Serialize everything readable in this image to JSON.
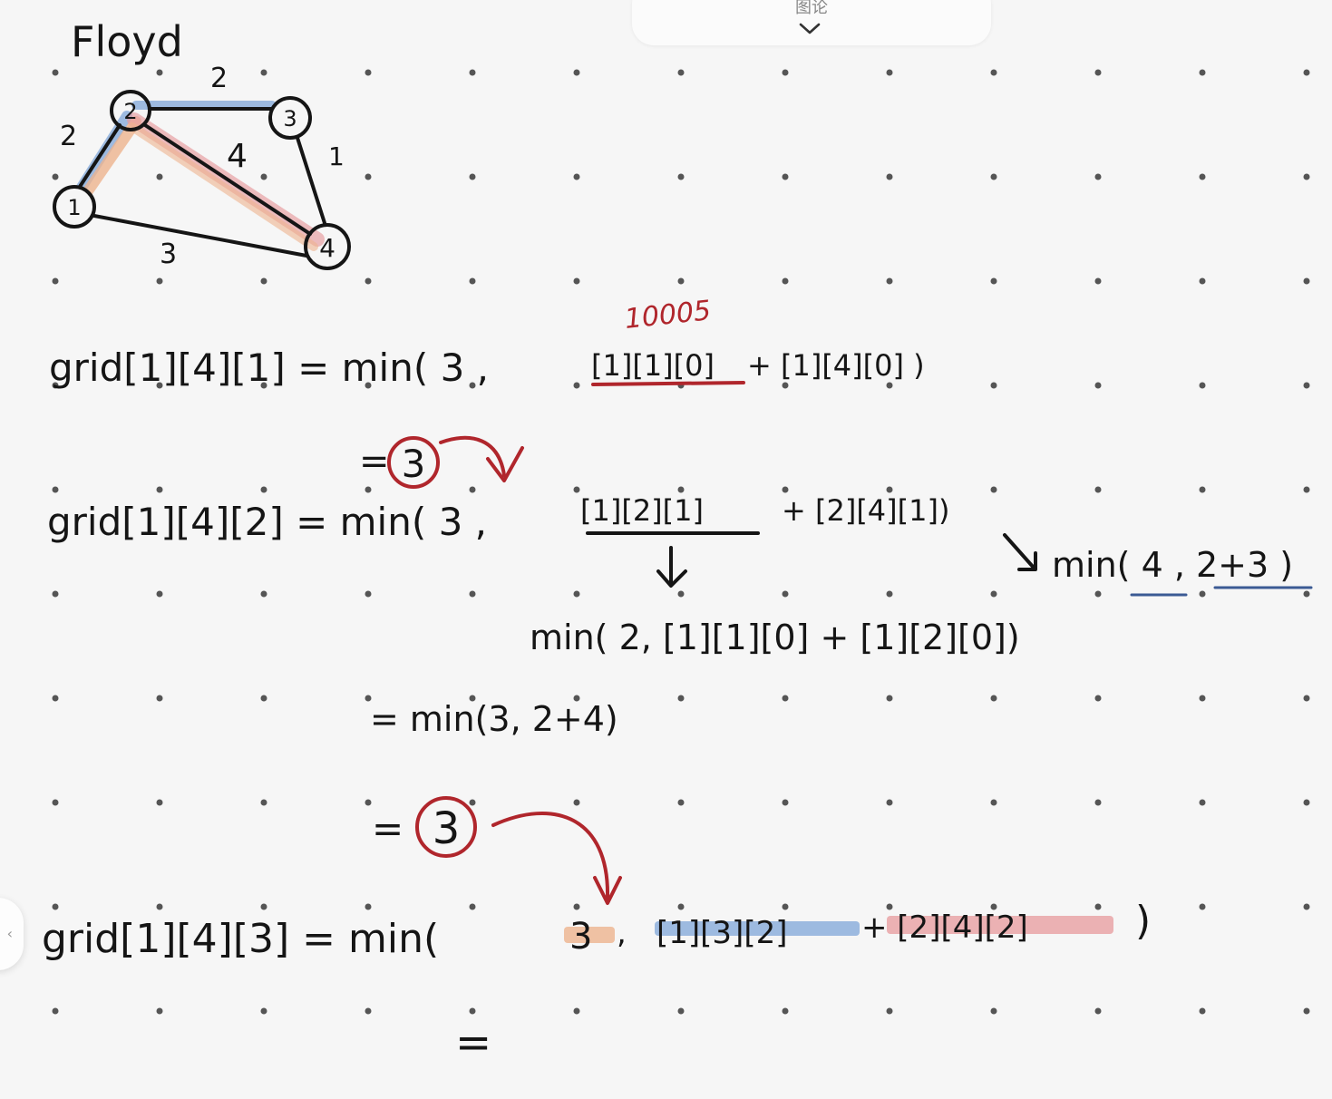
{
  "header": {
    "title": "图论",
    "chevron_icon": "chevron-down-icon"
  },
  "graph": {
    "title": "Floyd",
    "nodes": [
      {
        "label": "1"
      },
      {
        "label": "2"
      },
      {
        "label": "3"
      },
      {
        "label": "4"
      }
    ],
    "edges": [
      {
        "from": "1",
        "to": "2",
        "weight": "2"
      },
      {
        "from": "2",
        "to": "3",
        "weight": "2"
      },
      {
        "from": "2",
        "to": "4",
        "weight": "4"
      },
      {
        "from": "3",
        "to": "4",
        "weight": "1"
      },
      {
        "from": "1",
        "to": "4",
        "weight": "3"
      }
    ]
  },
  "notes": {
    "annotation_10005": "10005",
    "line1_lhs": "grid[1][4][1] = min( 3 ,",
    "line1_rhs_a": "[1][1][0]",
    "line1_rhs_b": "+ [1][4][0] )",
    "eq_3_a": "=",
    "circled_3_a": "3",
    "line2_lhs": "grid[1][4][2] = min( 3 ,",
    "line2_rhs_a": "[1][2][1]",
    "line2_rhs_b": "+ [2][4][1])",
    "side_min": "min( 4 , 2+3 )",
    "line3": "min( 2, [1][1][0] + [1][2][0])",
    "line4": "= min(3, 2+4)",
    "eq_3_b": "=",
    "circled_3_b": "3",
    "line5_lhs": "grid[1][4][3] = min(",
    "line5_three": "3",
    "line5_comma": ",",
    "line5_rhs_a": "[1][3][2]",
    "line5_rhs_b": "+ [2][4][2]",
    "line5_close": ")",
    "line6": "="
  },
  "colors": {
    "ink": "#151515",
    "red_ink": "#b0262c",
    "blue_highlight": "#7fa6d8",
    "pink_highlight": "#e79a9c",
    "orange_highlight": "#eeb48f",
    "blue_underline": "#3b5a94",
    "dot": "#555555",
    "background": "#f6f6f6"
  }
}
